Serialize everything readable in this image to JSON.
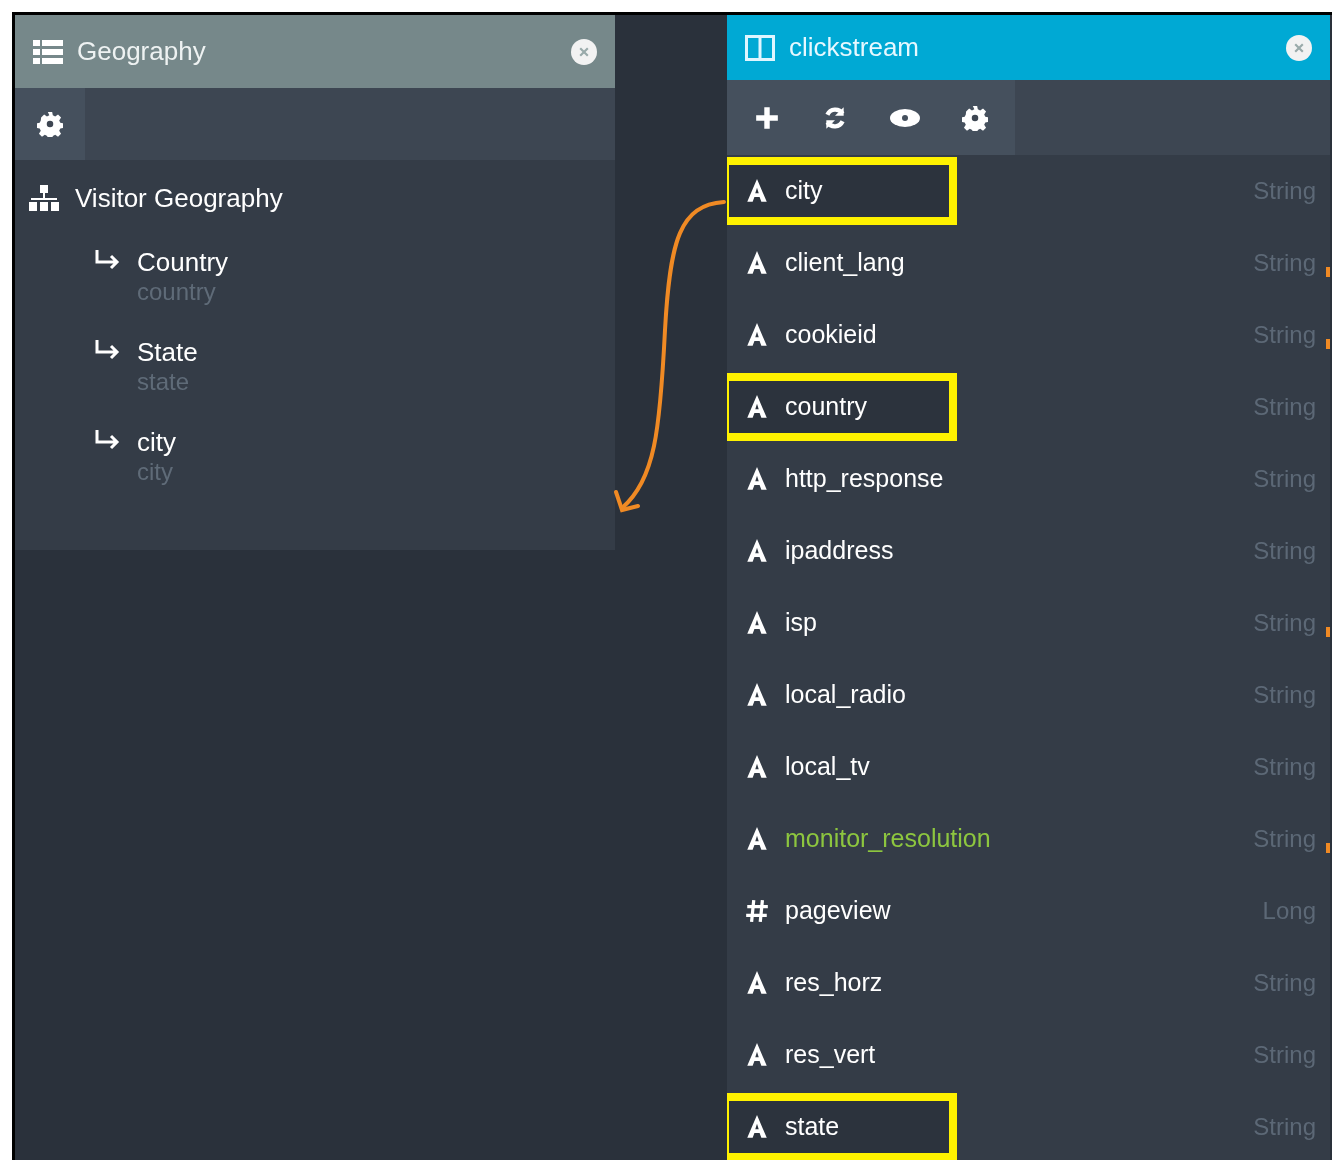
{
  "left_panel": {
    "title": "Geography",
    "hierarchy": {
      "name": "Visitor Geography",
      "children": [
        {
          "label": "Country",
          "column": "country"
        },
        {
          "label": "State",
          "column": "state"
        },
        {
          "label": "city",
          "column": "city"
        }
      ]
    }
  },
  "right_panel": {
    "title": "clickstream",
    "fields": [
      {
        "kind": "string",
        "name": "city",
        "type": "String",
        "highlighted": true,
        "linked": false,
        "color": "#ffffff"
      },
      {
        "kind": "string",
        "name": "client_lang",
        "type": "String",
        "highlighted": false,
        "linked": true,
        "color": "#ffffff"
      },
      {
        "kind": "string",
        "name": "cookieid",
        "type": "String",
        "highlighted": false,
        "linked": true,
        "color": "#ffffff"
      },
      {
        "kind": "string",
        "name": "country",
        "type": "String",
        "highlighted": true,
        "linked": false,
        "color": "#ffffff"
      },
      {
        "kind": "string",
        "name": "http_response",
        "type": "String",
        "highlighted": false,
        "linked": false,
        "color": "#ffffff"
      },
      {
        "kind": "string",
        "name": "ipaddress",
        "type": "String",
        "highlighted": false,
        "linked": false,
        "color": "#ffffff"
      },
      {
        "kind": "string",
        "name": "isp",
        "type": "String",
        "highlighted": false,
        "linked": true,
        "color": "#ffffff"
      },
      {
        "kind": "string",
        "name": "local_radio",
        "type": "String",
        "highlighted": false,
        "linked": false,
        "color": "#ffffff"
      },
      {
        "kind": "string",
        "name": "local_tv",
        "type": "String",
        "highlighted": false,
        "linked": false,
        "color": "#ffffff"
      },
      {
        "kind": "string",
        "name": "monitor_resolution",
        "type": "String",
        "highlighted": false,
        "linked": true,
        "color": "#8dc63f"
      },
      {
        "kind": "number",
        "name": "pageview",
        "type": "Long",
        "highlighted": false,
        "linked": false,
        "color": "#ffffff"
      },
      {
        "kind": "string",
        "name": "res_horz",
        "type": "String",
        "highlighted": false,
        "linked": false,
        "color": "#ffffff"
      },
      {
        "kind": "string",
        "name": "res_vert",
        "type": "String",
        "highlighted": false,
        "linked": false,
        "color": "#ffffff"
      },
      {
        "kind": "string",
        "name": "state",
        "type": "String",
        "highlighted": true,
        "linked": false,
        "color": "#ffffff"
      }
    ]
  }
}
